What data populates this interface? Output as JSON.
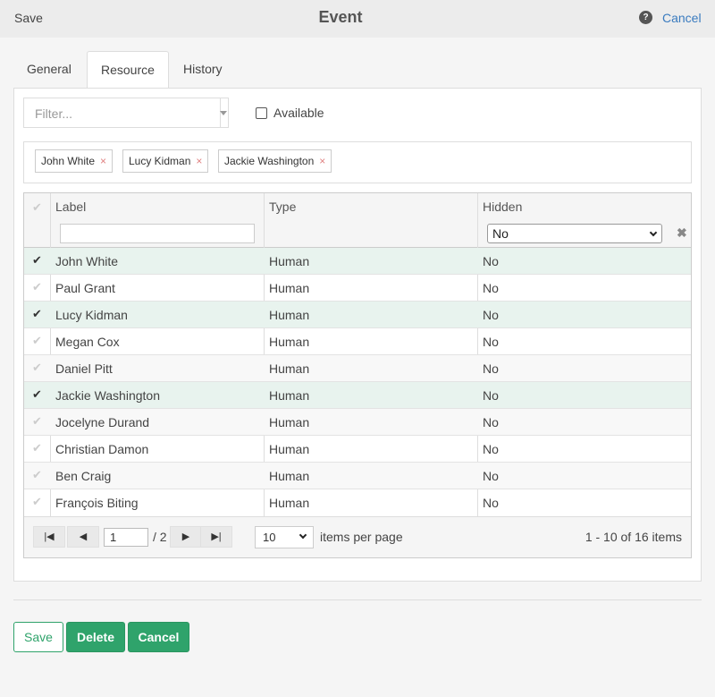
{
  "header": {
    "save_label": "Save",
    "title": "Event",
    "help_icon": "?",
    "cancel_label": "Cancel"
  },
  "tabs": [
    {
      "label": "General"
    },
    {
      "label": "Resource"
    },
    {
      "label": "History"
    }
  ],
  "filter": {
    "placeholder": "Filter..."
  },
  "available_label": "Available",
  "chips": [
    {
      "label": "John White"
    },
    {
      "label": "Lucy Kidman"
    },
    {
      "label": "Jackie Washington"
    }
  ],
  "grid": {
    "columns": {
      "label": "Label",
      "type": "Type",
      "hidden": "Hidden"
    },
    "hidden_filter_value": "No",
    "rows": [
      {
        "label": "John White",
        "type": "Human",
        "hidden": "No",
        "selected": true
      },
      {
        "label": "Paul Grant",
        "type": "Human",
        "hidden": "No",
        "selected": false
      },
      {
        "label": "Lucy Kidman",
        "type": "Human",
        "hidden": "No",
        "selected": true
      },
      {
        "label": "Megan Cox",
        "type": "Human",
        "hidden": "No",
        "selected": false
      },
      {
        "label": "Daniel Pitt",
        "type": "Human",
        "hidden": "No",
        "selected": false
      },
      {
        "label": "Jackie Washington",
        "type": "Human",
        "hidden": "No",
        "selected": true
      },
      {
        "label": "Jocelyne Durand",
        "type": "Human",
        "hidden": "No",
        "selected": false
      },
      {
        "label": "Christian Damon",
        "type": "Human",
        "hidden": "No",
        "selected": false
      },
      {
        "label": "Ben Craig",
        "type": "Human",
        "hidden": "No",
        "selected": false
      },
      {
        "label": "François Biting",
        "type": "Human",
        "hidden": "No",
        "selected": false
      }
    ]
  },
  "pager": {
    "page": "1",
    "of_pages": "/ 2",
    "per_page": "10",
    "per_page_label": "items per page",
    "info": "1 - 10 of 16 items"
  },
  "footer": {
    "save_label": "Save",
    "delete_label": "Delete",
    "cancel_label": "Cancel"
  },
  "colors": {
    "accent": "#2fa36b",
    "link": "#3a7bbf",
    "selected_row": "#e8f3ee"
  }
}
